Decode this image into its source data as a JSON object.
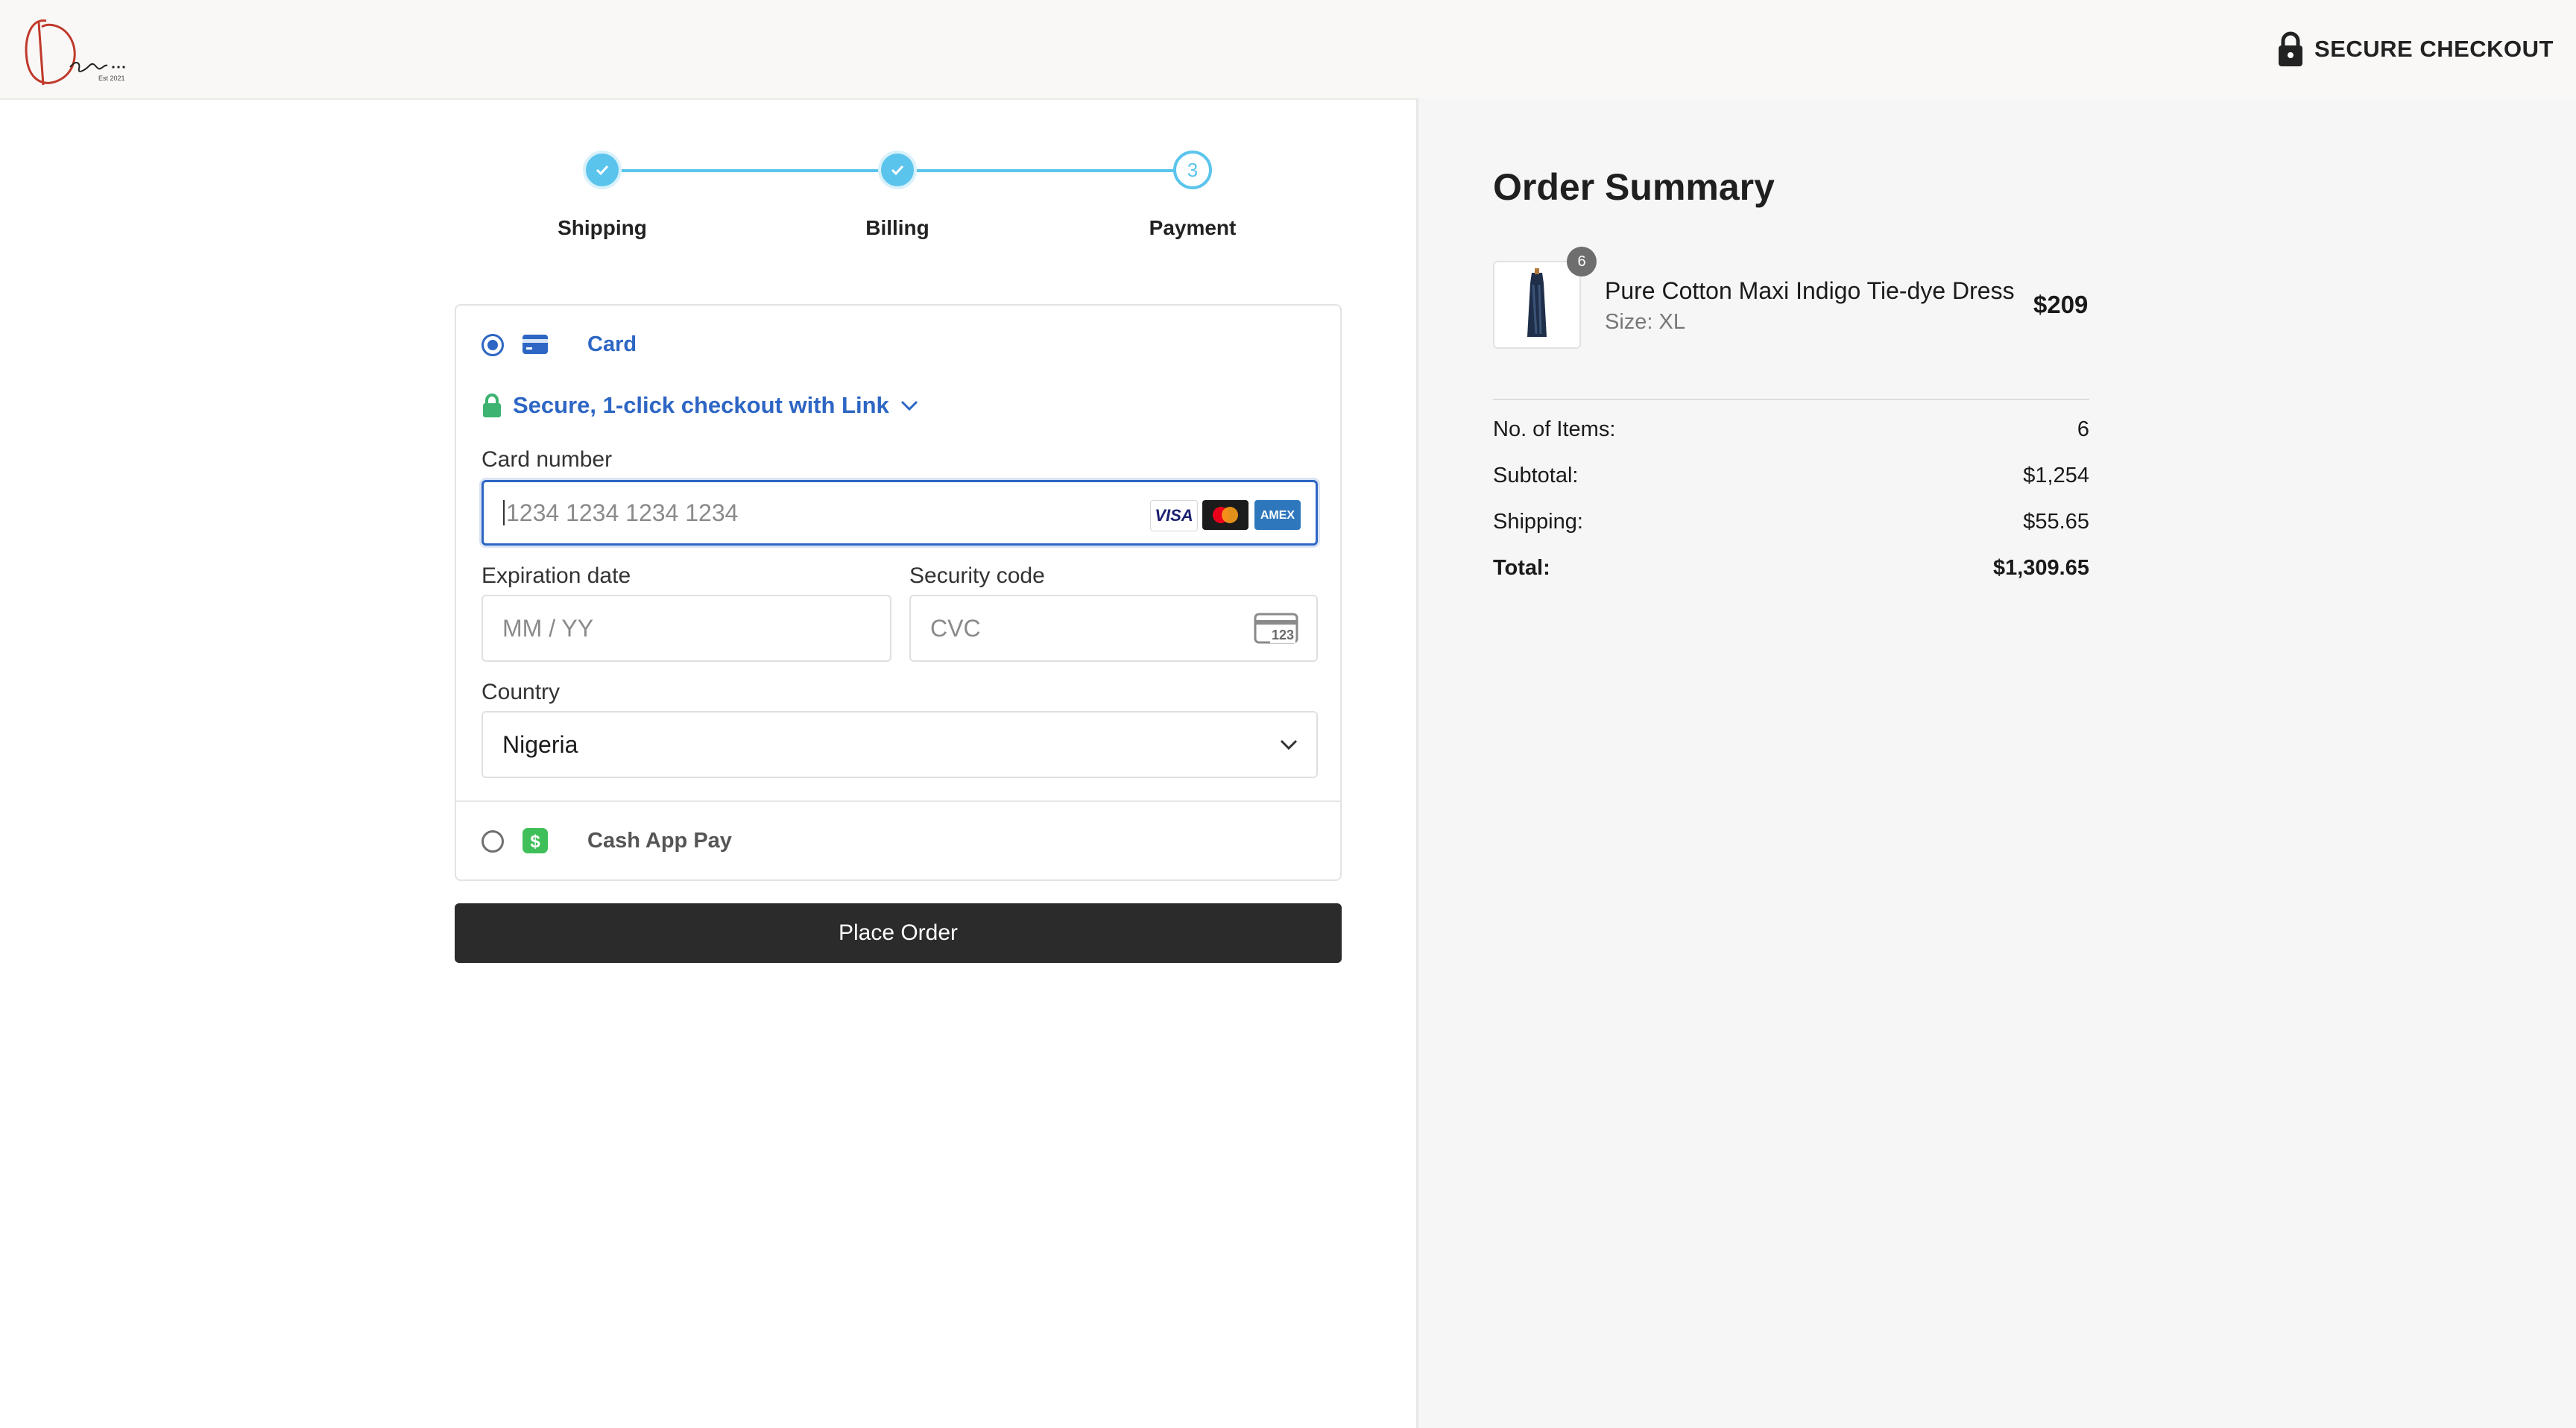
{
  "header": {
    "logo_name": "deedi-script-logo",
    "logo_tagline": "Est 2021",
    "secure_checkout_label": "SECURE CHECKOUT"
  },
  "stepper": {
    "steps": [
      {
        "label": "Shipping",
        "state": "done"
      },
      {
        "label": "Billing",
        "state": "done"
      },
      {
        "label": "Payment",
        "state": "active",
        "number": "3"
      }
    ],
    "color": "#5bc4ec"
  },
  "payment": {
    "methods": [
      {
        "label": "Card",
        "selected": true,
        "icon": "credit-card-icon",
        "color": "#2d66c4"
      },
      {
        "label": "Cash App Pay",
        "selected": false,
        "icon": "cash-app-icon",
        "color": "#00c244"
      }
    ],
    "link_text": "Secure, 1-click checkout with Link",
    "card_number": {
      "label": "Card number",
      "placeholder": "1234 1234 1234 1234",
      "brands": [
        "VISA",
        "Mastercard",
        "AMEX"
      ]
    },
    "expiration": {
      "label": "Expiration date",
      "placeholder": "MM / YY"
    },
    "security_code": {
      "label": "Security code",
      "placeholder": "CVC",
      "icon_text": "123"
    },
    "country": {
      "label": "Country",
      "value": "Nigeria"
    }
  },
  "place_order_label": "Place Order",
  "order_summary": {
    "title": "Order Summary",
    "item": {
      "name": "Pure Cotton Maxi Indigo Tie-dye Dress",
      "size": "Size: XL",
      "price": "$209",
      "quantity": "6"
    },
    "rows": [
      {
        "label": "No. of Items:",
        "value": "6"
      },
      {
        "label": "Subtotal:",
        "value": "$1,254"
      },
      {
        "label": "Shipping:",
        "value": "$55.65"
      },
      {
        "label": "Total:",
        "value": "$1,309.65"
      }
    ]
  }
}
